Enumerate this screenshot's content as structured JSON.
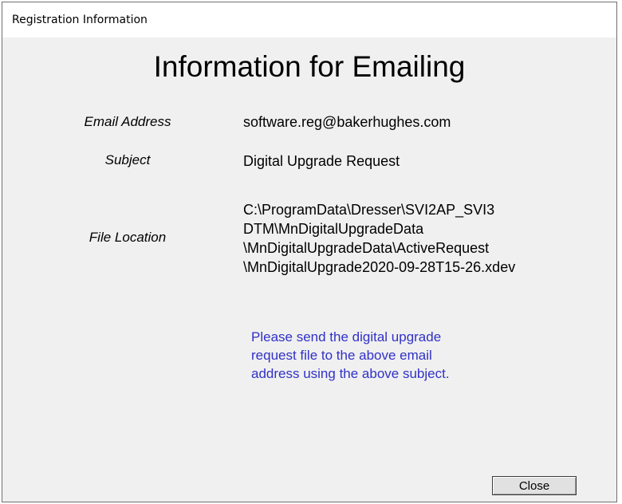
{
  "window": {
    "title": "Registration Information"
  },
  "main": {
    "heading": "Information for Emailing",
    "email_label": "Email Address",
    "email_value": "software.reg@bakerhughes.com",
    "subject_label": "Subject",
    "subject_value": "Digital Upgrade Request",
    "file_location_label": "File Location",
    "file_location_lines": [
      "C:\\ProgramData\\Dresser\\SVI2AP_SVI3",
      "DTM\\MnDigitalUpgradeData",
      "\\MnDigitalUpgradeData\\ActiveRequest",
      "\\MnDigitalUpgrade2020-09-28T15-26.xdev"
    ],
    "note_lines": [
      "Please send the digital upgrade",
      "request file to the above email",
      "address using the above subject."
    ]
  },
  "footer": {
    "close_label": "Close"
  },
  "colors": {
    "note_text": "#3131c8",
    "dialog_background": "#f0f0f0",
    "title_background": "#ffffff"
  }
}
